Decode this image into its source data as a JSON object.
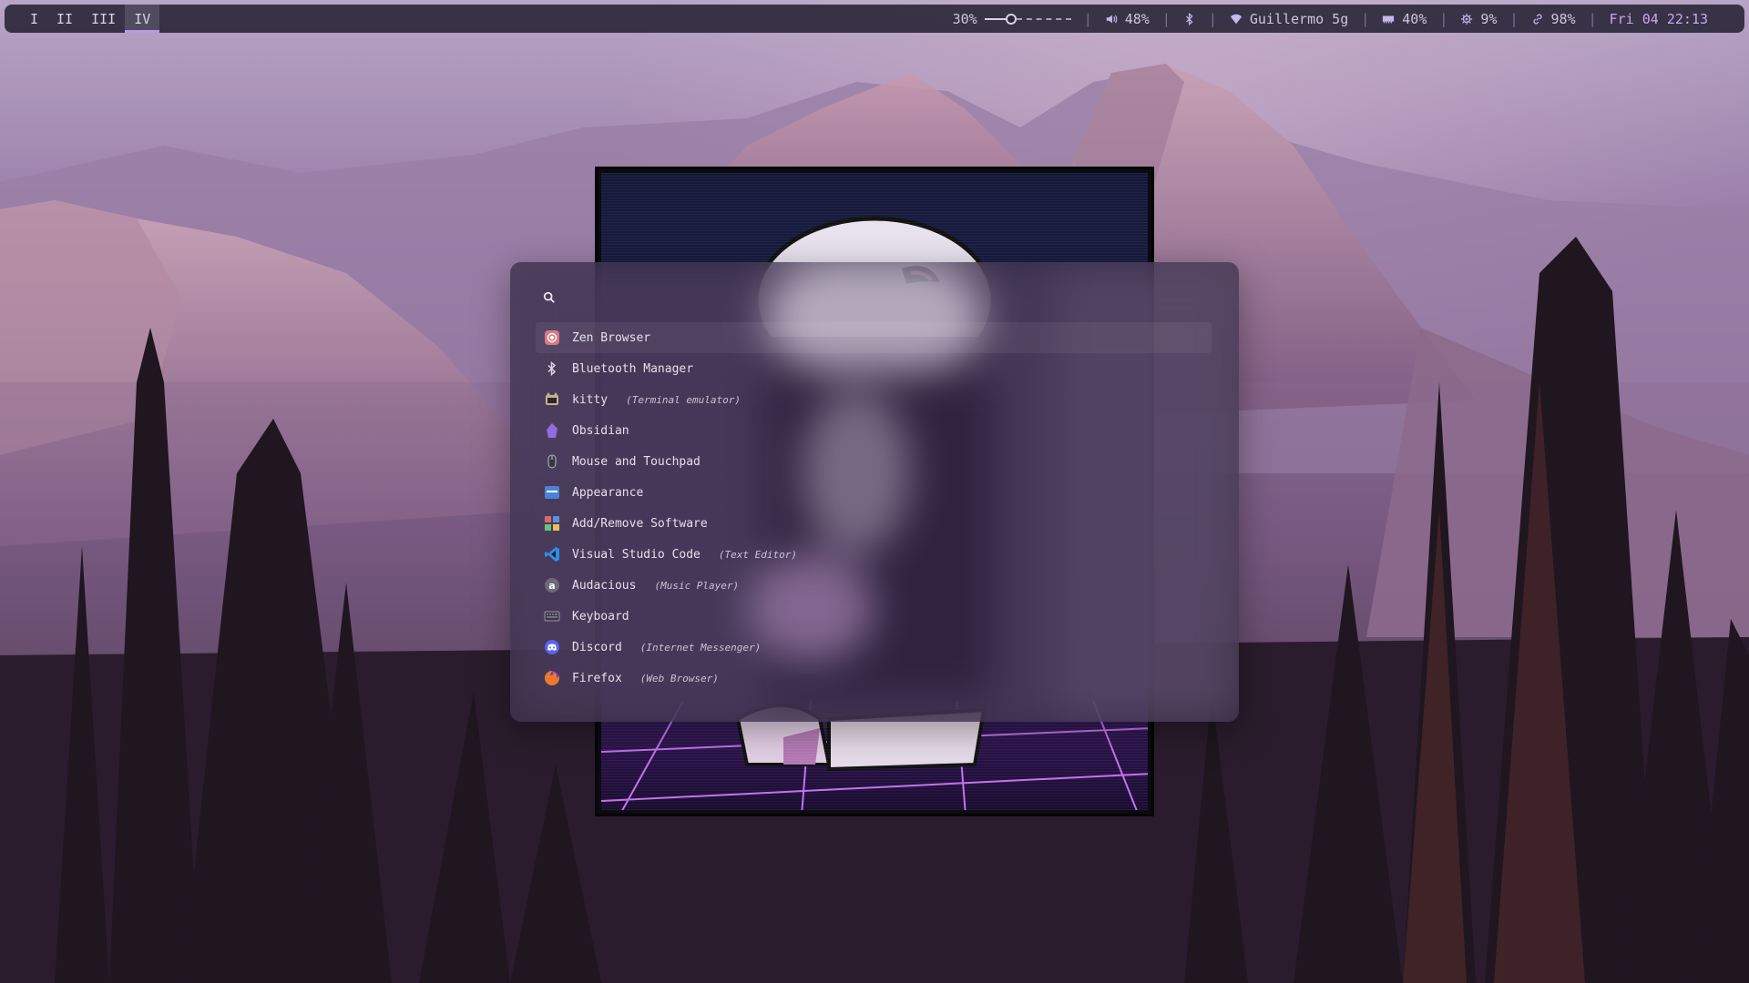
{
  "workspaces": [
    {
      "label": "I",
      "active": false
    },
    {
      "label": "II",
      "active": false
    },
    {
      "label": "III",
      "active": false
    },
    {
      "label": "IV",
      "active": true
    }
  ],
  "status": {
    "brightness": {
      "label": "30%",
      "level": 0.3,
      "icon": "brightness-slider-icon"
    },
    "volume": {
      "label": "48%",
      "icon": "speaker-icon"
    },
    "bluetooth": {
      "icon": "bluetooth-icon"
    },
    "network": {
      "label": "Guillermo 5g",
      "icon": "wifi-icon"
    },
    "memory": {
      "label": "40%",
      "icon": "memory-icon"
    },
    "cpu": {
      "label": "9%",
      "icon": "cpu-icon"
    },
    "battery": {
      "label": "98%",
      "icon": "link-icon"
    },
    "clock": "Fri 04 22:13"
  },
  "launcher": {
    "search_value": "",
    "search_icon": "search-icon",
    "items": [
      {
        "name": "Zen Browser",
        "desc": "",
        "icon": "zen-browser-icon",
        "color": "#d97a86",
        "selected": true
      },
      {
        "name": "Bluetooth Manager",
        "desc": "",
        "icon": "bluetooth-icon",
        "color": "#d8d2e4",
        "selected": false
      },
      {
        "name": "kitty",
        "desc": "(Terminal emulator)",
        "icon": "kitty-icon",
        "color": "#c9b08a",
        "selected": false
      },
      {
        "name": "Obsidian",
        "desc": "",
        "icon": "obsidian-icon",
        "color": "#8f6ce0",
        "selected": false
      },
      {
        "name": "Mouse and Touchpad",
        "desc": "",
        "icon": "mouse-icon",
        "color": "#bfbac8",
        "selected": false
      },
      {
        "name": "Appearance",
        "desc": "",
        "icon": "appearance-icon",
        "color": "#4a82d6",
        "selected": false
      },
      {
        "name": "Add/Remove Software",
        "desc": "",
        "icon": "software-icon",
        "color": "#d56b6b",
        "selected": false
      },
      {
        "name": "Visual Studio Code",
        "desc": "(Text Editor)",
        "icon": "vscode-icon",
        "color": "#2c8ee6",
        "selected": false
      },
      {
        "name": "Audacious",
        "desc": "(Music Player)",
        "icon": "audacious-icon",
        "color": "#6f6878",
        "selected": false
      },
      {
        "name": "Keyboard",
        "desc": "",
        "icon": "keyboard-icon",
        "color": "#9c97a6",
        "selected": false
      },
      {
        "name": "Discord",
        "desc": "(Internet Messenger)",
        "icon": "discord-icon",
        "color": "#5865f2",
        "selected": false
      },
      {
        "name": "Firefox",
        "desc": "(Web Browser)",
        "icon": "firefox-icon",
        "color": "#f0782a",
        "selected": false
      }
    ]
  },
  "colors": {
    "accent": "#b69be6",
    "clock": "#c9a6ef"
  }
}
